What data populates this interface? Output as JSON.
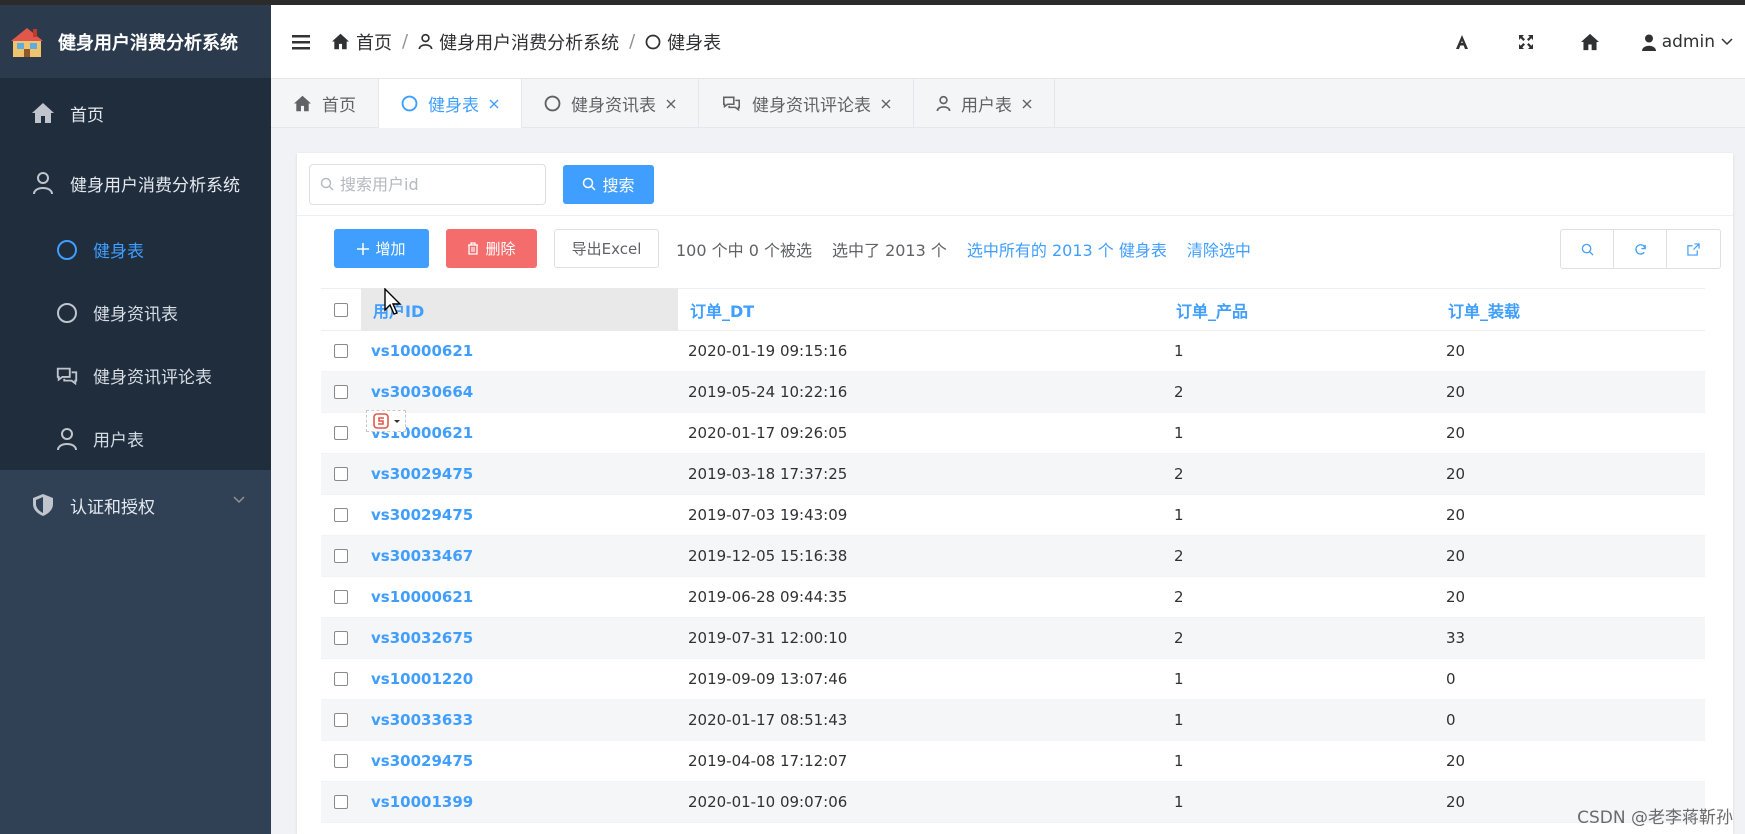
{
  "app": {
    "title": "健身用户消费分析系统"
  },
  "sidebar": {
    "items": [
      {
        "label": "首页",
        "icon": "home-icon"
      },
      {
        "label": "健身用户消费分析系统",
        "icon": "user-icon"
      }
    ],
    "sub_items": [
      {
        "label": "健身表",
        "icon": "circle-icon",
        "active": true
      },
      {
        "label": "健身资讯表",
        "icon": "circle-icon"
      },
      {
        "label": "健身资讯评论表",
        "icon": "comments-icon"
      },
      {
        "label": "用户表",
        "icon": "user-icon"
      }
    ],
    "auth": {
      "label": "认证和授权",
      "icon": "shield-icon"
    }
  },
  "header": {
    "breadcrumb": [
      "首页",
      "健身用户消费分析系统",
      "健身表"
    ],
    "separator": "/",
    "user": "admin"
  },
  "tabs": [
    {
      "label": "首页",
      "closable": false
    },
    {
      "label": "健身表",
      "closable": true,
      "active": true
    },
    {
      "label": "健身资讯表",
      "closable": true
    },
    {
      "label": "健身资讯评论表",
      "closable": true
    },
    {
      "label": "用户表",
      "closable": true
    }
  ],
  "search": {
    "placeholder": "搜索用户id",
    "button": "搜索"
  },
  "toolbar": {
    "add": "增加",
    "delete": "删除",
    "export": "导出Excel",
    "selection_info": "100 个中 0 个被选",
    "selected_count": "选中了 2013 个",
    "select_all": "选中所有的 2013 个 健身表",
    "clear": "清除选中"
  },
  "table": {
    "columns": [
      "用户ID",
      "订单_DT",
      "订单_产品",
      "订单_装载"
    ],
    "rows": [
      {
        "uid": "vs10000621",
        "dt": "2020-01-19 09:15:16",
        "prod": "1",
        "load": "20"
      },
      {
        "uid": "vs30030664",
        "dt": "2019-05-24 10:22:16",
        "prod": "2",
        "load": "20"
      },
      {
        "uid": "vs10000621",
        "dt": "2020-01-17 09:26:05",
        "prod": "1",
        "load": "20"
      },
      {
        "uid": "vs30029475",
        "dt": "2019-03-18 17:37:25",
        "prod": "2",
        "load": "20"
      },
      {
        "uid": "vs30029475",
        "dt": "2019-07-03 19:43:09",
        "prod": "1",
        "load": "20"
      },
      {
        "uid": "vs30033467",
        "dt": "2019-12-05 15:16:38",
        "prod": "2",
        "load": "20"
      },
      {
        "uid": "vs10000621",
        "dt": "2019-06-28 09:44:35",
        "prod": "2",
        "load": "20"
      },
      {
        "uid": "vs30032675",
        "dt": "2019-07-31 12:00:10",
        "prod": "2",
        "load": "33"
      },
      {
        "uid": "vs10001220",
        "dt": "2019-09-09 13:07:46",
        "prod": "1",
        "load": "0"
      },
      {
        "uid": "vs30033633",
        "dt": "2020-01-17 08:51:43",
        "prod": "1",
        "load": "0"
      },
      {
        "uid": "vs30029475",
        "dt": "2019-04-08 17:12:07",
        "prod": "1",
        "load": "20"
      },
      {
        "uid": "vs10001399",
        "dt": "2020-01-10 09:07:06",
        "prod": "1",
        "load": "20"
      }
    ]
  },
  "watermark": "CSDN @老李蒋靳孙",
  "colors": {
    "primary": "#409eff",
    "danger": "#f56c6c",
    "sidebar": "#304156",
    "sidebar_dark": "#1f2d3d"
  }
}
